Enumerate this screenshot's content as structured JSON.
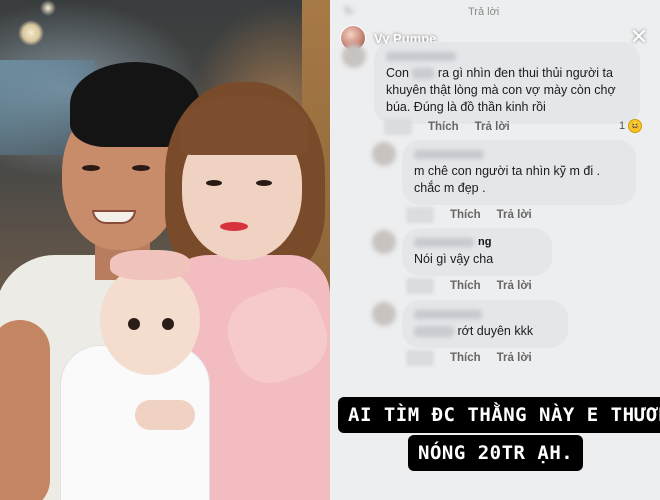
{
  "story": {
    "header_top_text": "Trả lời",
    "username": "Vy Pumpe",
    "close_icon": "close-icon"
  },
  "comments": [
    {
      "text_prefix": "Con",
      "text_rest": "ra gì nhìn đen thui thủi người ta khuyên thật lòng mà con vợ mày còn chợ búa. Đúng là đồ thần kinh rồi",
      "like": "Thích",
      "reply": "Trả lời",
      "reaction_count": "1",
      "reaction_icon": "haha-emoji-icon"
    },
    {
      "name_suffix": "",
      "text": "m chê con người ta nhìn kỹ m đi . chắc m đẹp .",
      "like": "Thích",
      "reply": "Trả lời"
    },
    {
      "name_suffix": "ng",
      "text": "Nói gì vậy cha",
      "like": "Thích",
      "reply": "Trả lời"
    },
    {
      "text": "rớt duyên kkk",
      "like": "Thích",
      "reply": "Trả lời"
    }
  ],
  "caption": {
    "line1": "AI TÌM ĐC THẰNG NÀY E THƯỞNG",
    "line2": "NÓNG 20TR ẠH."
  }
}
